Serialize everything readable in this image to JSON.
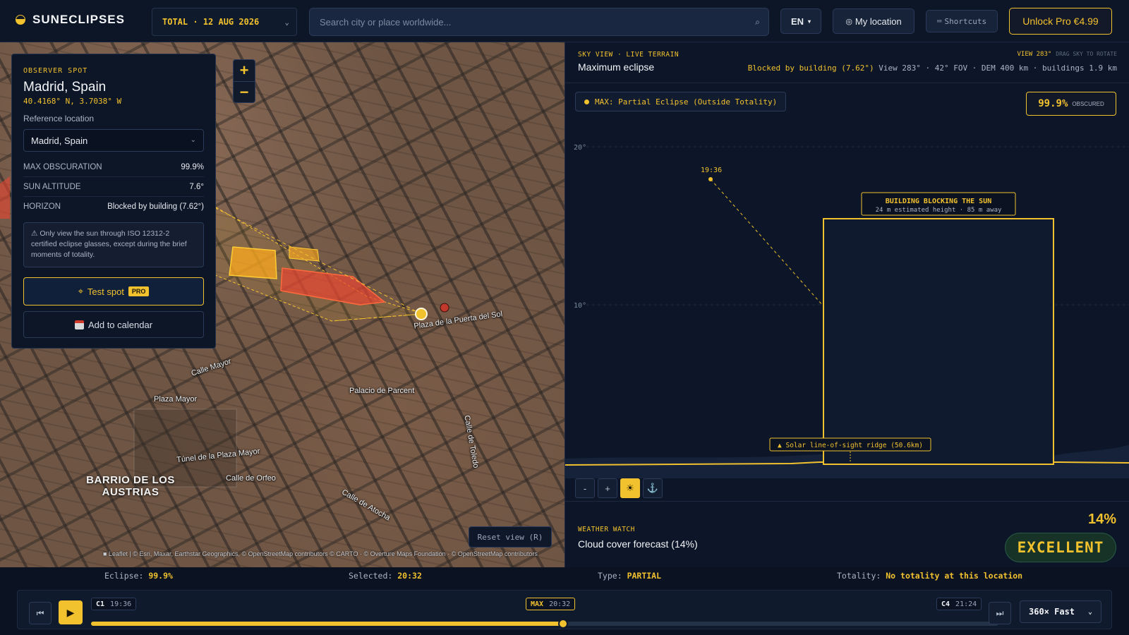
{
  "app": {
    "name": "SUNECLIPSES",
    "event": "TOTAL · 12 AUG 2026"
  },
  "search": {
    "placeholder": "Search city or place worldwide..."
  },
  "header": {
    "language": "EN",
    "my_location": "My location",
    "shortcuts": "Shortcuts",
    "unlock": "Unlock Pro €4.99"
  },
  "map": {
    "zoom_in": "+",
    "zoom_out": "−",
    "district": "BARRIO DE LOS AUSTRIAS",
    "labels": {
      "plaza": "Plaza de la Puerta del Sol",
      "calle_mayor": "Calle Mayor",
      "plaza_mayor": "Plaza Mayor",
      "tunel": "Túnel de la Plaza Mayor",
      "palacio": "Palacio de Parcent",
      "calle_toledo": "Calle de Toledo",
      "calle_atocha": "Calle de Atocha",
      "calle_oriente": "Calle de Orfeo"
    },
    "reset": "Reset view (R)",
    "attribution": "■ Leaflet | © Esri, Maxar, Earthstar Geographics, © OpenStreetMap contributors © CARTO · © Overture Maps Foundation · © OpenStreetMap contributors"
  },
  "observer": {
    "eyebrow": "OBSERVER SPOT",
    "city": "Madrid, Spain",
    "coords": "40.4168° N, 3.7038° W",
    "reference_label": "Reference location",
    "reference_value": "Madrid, Spain",
    "rows": [
      {
        "k": "MAX OBSCURATION",
        "v": "99.9%"
      },
      {
        "k": "SUN ALTITUDE",
        "v": "7.6°"
      },
      {
        "k": "HORIZON",
        "v": "Blocked by building (7.62°)"
      }
    ],
    "warning": "⚠ Only view the sun through ISO 12312-2 certified eclipse glasses, except during the brief moments of totality.",
    "test_spot": "Test spot",
    "pro": "PRO",
    "calendar": "Add to calendar"
  },
  "sky": {
    "eyebrow": "SKY VIEW · LIVE TERRAIN",
    "title": "Maximum eclipse",
    "view": "VIEW 283°",
    "drag_hint": "DRAG SKY TO ROTATE",
    "meta_blocked": "Blocked by building (7.62°)",
    "meta_rest": "View 283° · 42° FOV · DEM 400 km · buildings 1.9 km",
    "max_pill": "MAX: Partial Eclipse (Outside Totality)",
    "obscured_pct": "99.9%",
    "obscured_label": "OBSCURED",
    "tick_20": "20°",
    "tick_10": "10°",
    "sun_time": "19:36",
    "building_title": "BUILDING BLOCKING THE SUN",
    "building_sub": "24 m estimated height · 85 m away",
    "ridge": "▲ Solar line-of-sight ridge (50.6km)",
    "tools": [
      "-",
      "+",
      "☀",
      "⚓"
    ]
  },
  "weather": {
    "eyebrow": "WEATHER WATCH",
    "title": "Cloud cover forecast (14%)",
    "pct": "14%",
    "badge": "EXCELLENT"
  },
  "status": {
    "eclipse_label": "Eclipse:",
    "eclipse_value": "99.9%",
    "selected_label": "Selected:",
    "selected_value": "20:32",
    "type_label": "Type:",
    "type_value": "PARTIAL",
    "totality_label": "Totality:",
    "totality_value": "No totality at this location"
  },
  "timeline": {
    "c1_label": "C1",
    "c1_time": "19:36",
    "max_label": "MAX",
    "max_time": "20:32",
    "c4_label": "C4",
    "c4_time": "21:24",
    "progress": 0.52,
    "speed": "360× Fast",
    "rewind": "⏮",
    "play": "▶",
    "forward": "⏭"
  },
  "colors": {
    "accent": "#f2c12e",
    "panel": "#0d1626",
    "excellent_bg": "#173328"
  }
}
